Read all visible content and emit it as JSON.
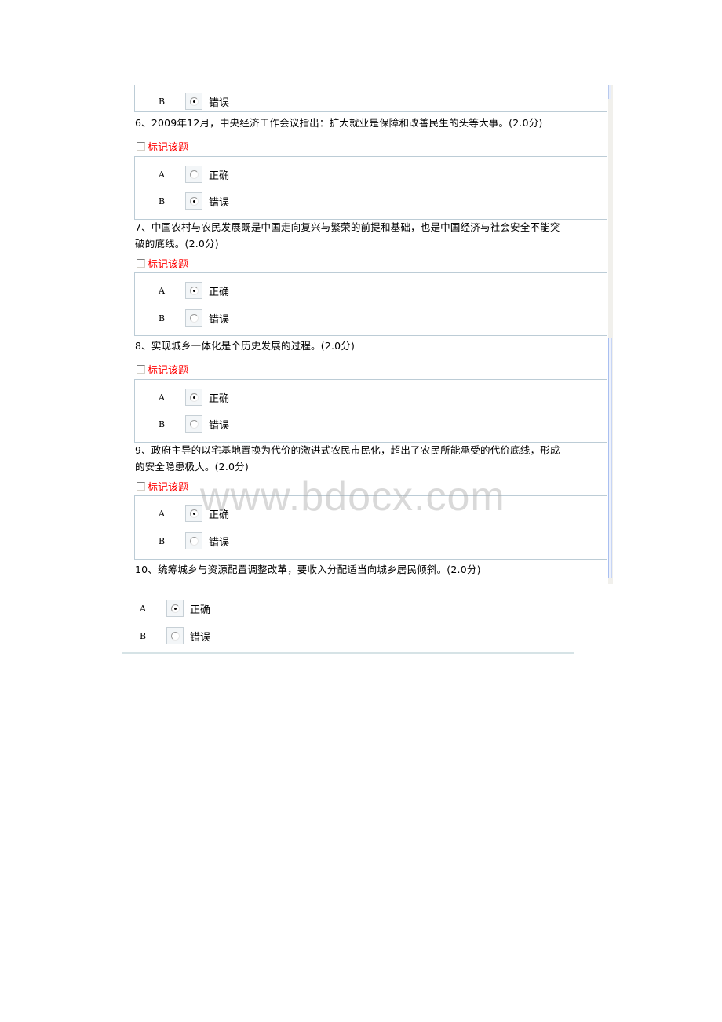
{
  "partial_top": {
    "option": {
      "letter": "B",
      "text": "错误",
      "selected": true
    }
  },
  "mark_label": "标记该题",
  "questions": [
    {
      "number": "6",
      "text": "6、2009年12月，中央经济工作会议指出：扩大就业是保障和改善民生的头等大事。(2.0分)",
      "options": [
        {
          "letter": "A",
          "text": "正确",
          "selected": false
        },
        {
          "letter": "B",
          "text": "错误",
          "selected": true
        }
      ]
    },
    {
      "number": "7",
      "text_line1": "7、中国农村与农民发展既是中国走向复兴与繁荣的前提和基础，也是中国经济与社会安全不能突",
      "text_line2": "破的底线。(2.0分)",
      "options": [
        {
          "letter": "A",
          "text": "正确",
          "selected": true
        },
        {
          "letter": "B",
          "text": "错误",
          "selected": false
        }
      ]
    },
    {
      "number": "8",
      "text": "8、实现城乡一体化是个历史发展的过程。(2.0分)",
      "options": [
        {
          "letter": "A",
          "text": "正确",
          "selected": true
        },
        {
          "letter": "B",
          "text": "错误",
          "selected": false
        }
      ]
    },
    {
      "number": "9",
      "text_line1": "9、政府主导的以宅基地置换为代价的激进式农民市民化，超出了农民所能承受的代价底线，形成",
      "text_line2": "的安全隐患极大。(2.0分)",
      "options": [
        {
          "letter": "A",
          "text": "正确",
          "selected": true
        },
        {
          "letter": "B",
          "text": "错误",
          "selected": false
        }
      ]
    },
    {
      "number": "10",
      "text": "10、统筹城乡与资源配置调整改革，要收入分配适当向城乡居民倾斜。(2.0分)",
      "options": [
        {
          "letter": "A",
          "text": "正确",
          "selected": true
        },
        {
          "letter": "B",
          "text": "错误",
          "selected": false
        }
      ]
    }
  ],
  "watermark": "www.bdocx.com"
}
